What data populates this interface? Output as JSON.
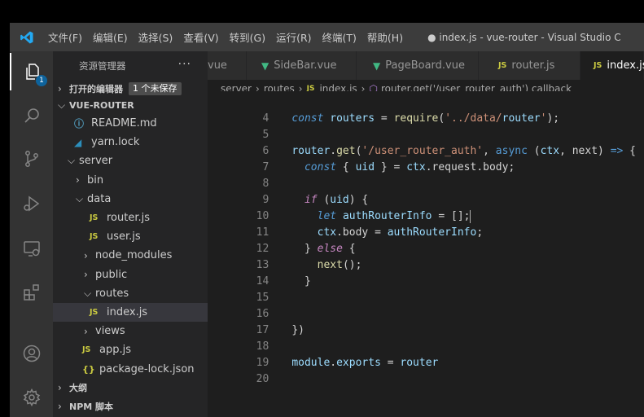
{
  "menubar": {
    "items": [
      "文件(F)",
      "编辑(E)",
      "选择(S)",
      "查看(V)",
      "转到(G)",
      "运行(R)",
      "终端(T)",
      "帮助(H)"
    ],
    "window_title": "● index.js - vue-router - Visual Studio C"
  },
  "activity": {
    "badge": "1",
    "icons": [
      "explorer-icon",
      "search-icon",
      "source-control-icon",
      "run-debug-icon",
      "remote-explorer-icon",
      "extensions-icon",
      "account-icon",
      "settings-gear-icon"
    ]
  },
  "sidebar": {
    "title": "资源管理器",
    "more": "···",
    "open_editors": {
      "label": "打开的编辑器",
      "badge": "1 个未保存"
    },
    "root": "VUE-ROUTER",
    "tree": [
      {
        "label": "README.md"
      },
      {
        "label": "yarn.lock"
      },
      {
        "label": "server"
      },
      {
        "label": "bin"
      },
      {
        "label": "data"
      },
      {
        "label": "router.js"
      },
      {
        "label": "user.js"
      },
      {
        "label": "node_modules"
      },
      {
        "label": "public"
      },
      {
        "label": "routes"
      },
      {
        "label": "index.js"
      },
      {
        "label": "views"
      },
      {
        "label": "app.js"
      },
      {
        "label": "package-lock.json"
      }
    ],
    "outline": "大纲",
    "npm": "NPM 脚本"
  },
  "tabs": [
    {
      "label": "vue"
    },
    {
      "label": "SideBar.vue"
    },
    {
      "label": "PageBoard.vue"
    },
    {
      "label": "router.js"
    },
    {
      "label": "index.js"
    }
  ],
  "breadcrumb": [
    "server",
    "routes",
    "index.js",
    "router.get('/user_router_auth') callback"
  ],
  "editor": {
    "line_numbers": [
      "4",
      "5",
      "6",
      "7",
      "8",
      "9",
      "10",
      "11",
      "12",
      "13",
      "14",
      "15",
      "16",
      "17",
      "18",
      "19",
      "20"
    ],
    "lines": [
      "const routers = require('../data/router');",
      "",
      "router.get('/user_router_auth', async (ctx, next) => {",
      "  const { uid } = ctx.request.body;",
      "",
      "  if (uid) {",
      "    let authRouterInfo = [];",
      "    ctx.body = authRouterInfo;",
      "  } else {",
      "    next();",
      "  }",
      "",
      "",
      "})",
      "",
      "module.exports = router",
      ""
    ]
  },
  "colors": {
    "keyword": "#569cd6",
    "control": "#c586c0",
    "string": "#ce9178",
    "function": "#dcdcaa",
    "variable": "#9cdcfe",
    "vue": "#41b883",
    "js": "#cbcb41",
    "accent": "#0e639c"
  }
}
